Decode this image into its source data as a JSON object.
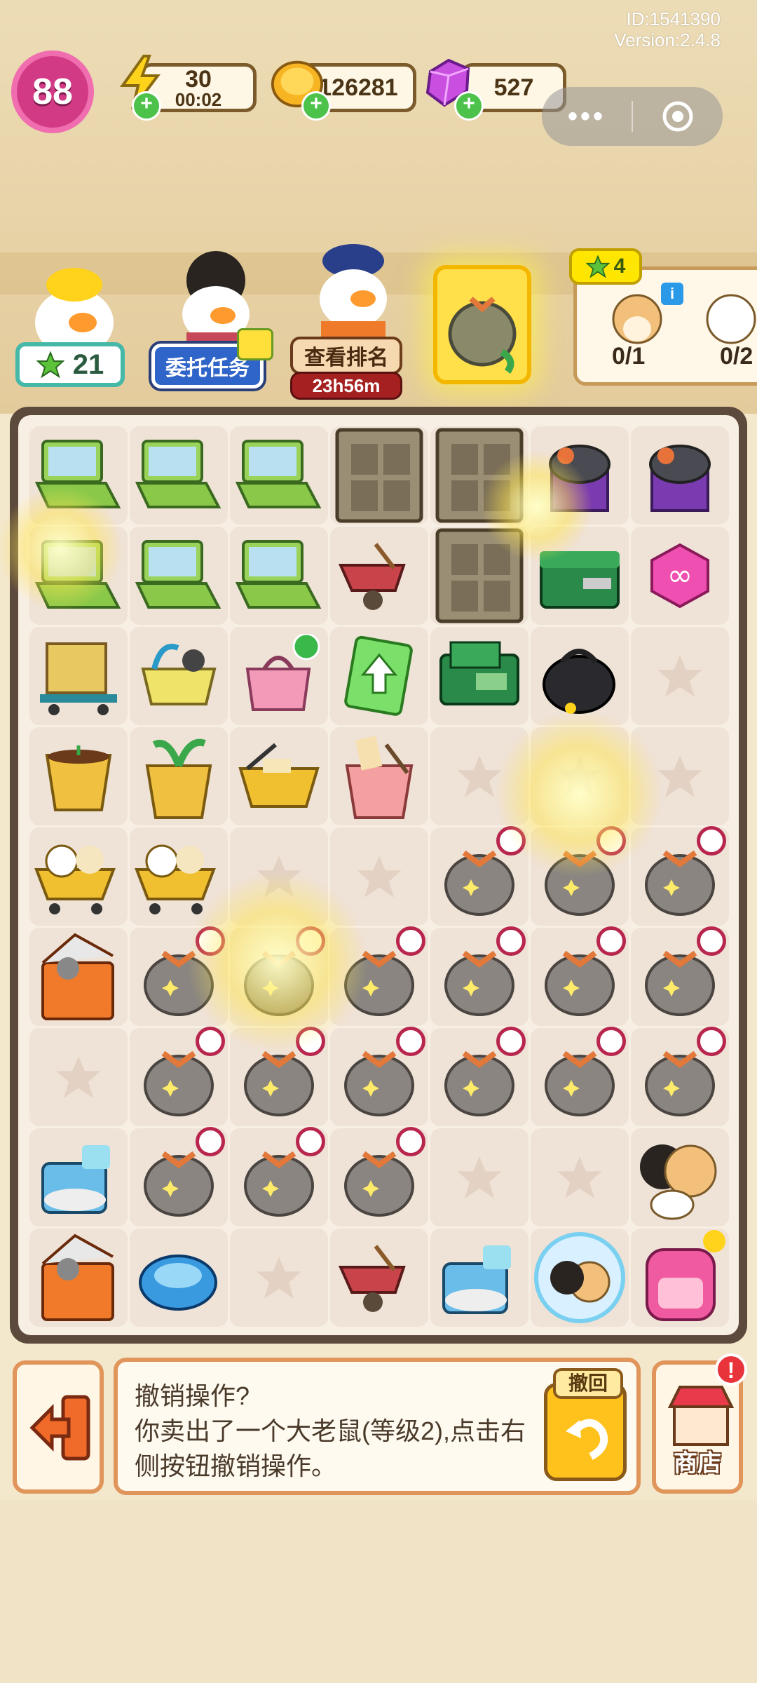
{
  "meta": {
    "id_text": "ID:1541390",
    "version_text": "Version:2.4.8"
  },
  "status": {
    "level": "88",
    "energy": {
      "value": "30",
      "timer": "00:02"
    },
    "coins": {
      "value": "126281"
    },
    "gems": {
      "value": "527"
    }
  },
  "capsule": {
    "more": "•••"
  },
  "characters": [
    {
      "badge": "21"
    },
    {
      "badge": "委托任务"
    },
    {
      "badge": "查看排名",
      "timer": "23h56m"
    }
  ],
  "quest": {
    "stars": "4",
    "slots": [
      "0/1",
      "0/2"
    ]
  },
  "board": {
    "rows": [
      [
        "laptop",
        "laptop",
        "laptop",
        "locker",
        "locker",
        "trash-bin",
        "trash-bin"
      ],
      [
        "laptop",
        "laptop",
        "laptop",
        "wheelbarrow",
        "locker",
        "toolbox",
        "infinity-token"
      ],
      [
        "cardboard-cart",
        "shopping-basket-blue",
        "pink-bag-locked",
        "upgrade-card",
        "green-machine",
        "black-bag",
        "empty"
      ],
      [
        "flower-pot",
        "sprout-pot",
        "yellow-basket",
        "bucket",
        "empty",
        "empty",
        "empty"
      ],
      [
        "duck-cart",
        "duck-cart",
        "empty",
        "empty",
        "timed-bag",
        "timed-bag",
        "timed-bag"
      ],
      [
        "cooler",
        "timed-bag",
        "timed-bag",
        "timed-bag",
        "timed-bag",
        "timed-bag",
        "timed-bag"
      ],
      [
        "empty",
        "timed-bag",
        "timed-bag",
        "timed-bag",
        "timed-bag",
        "timed-bag",
        "timed-bag"
      ],
      [
        "robot-vacuum-base",
        "timed-bag",
        "timed-bag",
        "timed-bag",
        "empty",
        "empty",
        "hamster-group"
      ],
      [
        "cooler",
        "robot-vacuum",
        "empty",
        "wheelbarrow",
        "robot-vacuum-base",
        "hamster-bubble",
        "pink-backpack"
      ]
    ]
  },
  "undo": {
    "title": "撤销操作?",
    "body": "你卖出了一个大老鼠(等级2),点击右侧按钮撤销操作。",
    "button_label": "撤回"
  },
  "shop": {
    "label": "商店"
  },
  "colors": {
    "accent_pink": "#d23a86",
    "plus_green": "#4cc24a",
    "board_frame": "#5c4a3c",
    "timer_red": "#b8264e",
    "button_orange": "#e0955b"
  },
  "icons": [
    "lightning-icon",
    "coin-icon",
    "gem-icon",
    "star-icon",
    "exit-icon",
    "undo-arrow-icon",
    "shop-icon",
    "info-icon",
    "alert-icon",
    "target-icon"
  ]
}
